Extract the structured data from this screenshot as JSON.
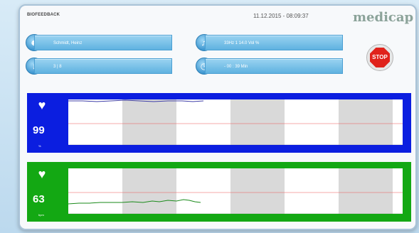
{
  "app": {
    "title": "BIOFEEDBACK",
    "datetime": "11.12.2015 - 08:09:37",
    "logo": "medicap"
  },
  "patient": {
    "name": "Schmidt, Heinz",
    "level": "3   |   8"
  },
  "session": {
    "volume": "33Hz    1 14.0 Vol %",
    "time": "- 00 : 39    Min"
  },
  "stop_button": {
    "label": "STOP"
  },
  "icons": {
    "user": "user-icon",
    "thermometer": "thermometer-icon",
    "sound": "sound-icon",
    "clock": "clock-icon",
    "heart": "heart-icon"
  },
  "colors": {
    "blue_panel": "#0b1ee0",
    "green_panel": "#13a813",
    "field": "#5fb2e0",
    "stop": "#e0221b"
  },
  "panels": [
    {
      "value": "99",
      "unit": "%"
    },
    {
      "value": "63",
      "unit": "bpm"
    }
  ]
}
